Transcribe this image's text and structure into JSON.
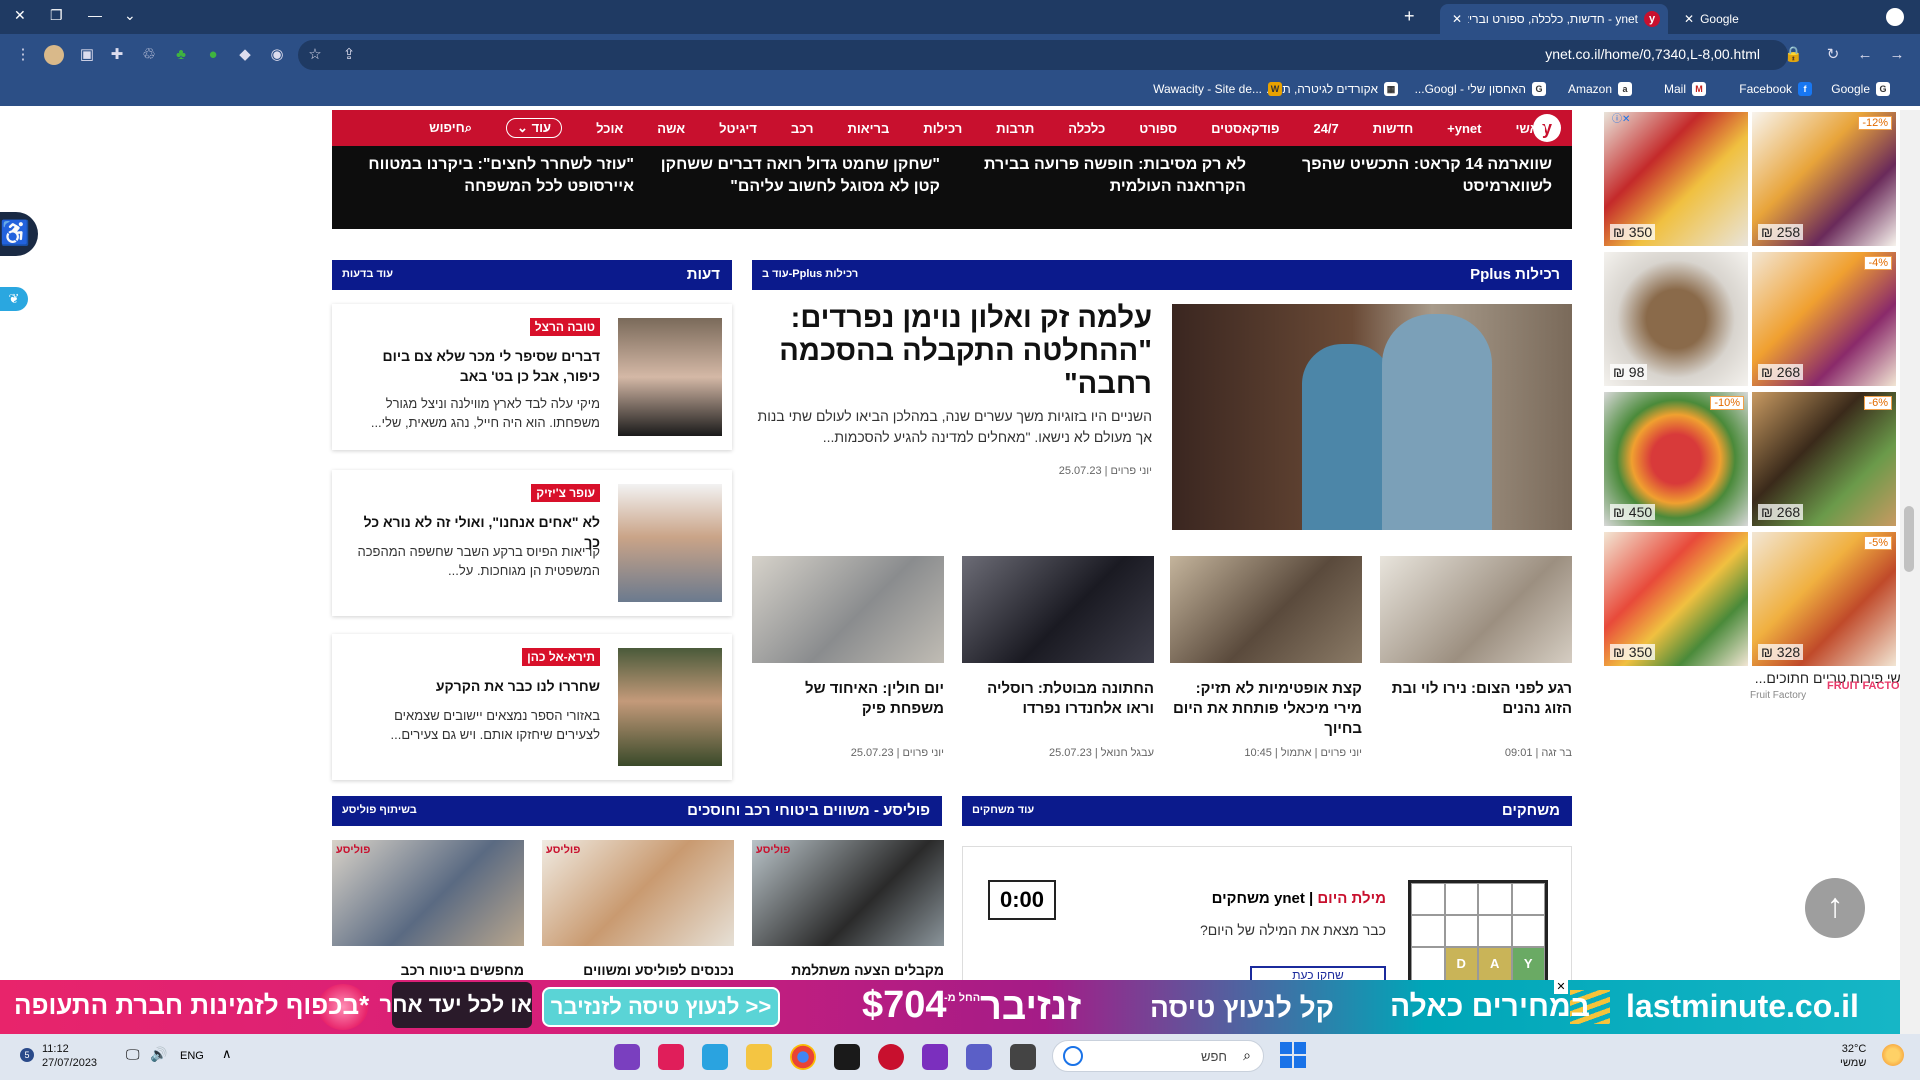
{
  "browser": {
    "tabs": [
      {
        "title": "Google",
        "favicon": "google-icon"
      },
      {
        "title": "ynet - חדשות, כלכלה, ספורט ובריאות - דיווחים שוטפים מהארץ ומהעולם",
        "favicon": "ynet-icon"
      }
    ],
    "url": "ynet.co.il/home/0,7340,L-8,00.html",
    "bookmarks": [
      "Google",
      "Facebook",
      "Mail",
      "Amazon",
      "האחסון שלי - Googl...",
      "אקורדים לגיטרה, תוו...",
      "Wawacity - Site de..."
    ]
  },
  "nav": {
    "logo": "y",
    "items": [
      "ראשי",
      "ynet+",
      "חדשות",
      "24/7",
      "פודקאסטים",
      "ספורט",
      "כלכלה",
      "תרבות",
      "רכילות",
      "בריאות",
      "רכב",
      "דיגיטל",
      "אשה",
      "אוכל"
    ],
    "more": "עוד",
    "search": "חיפוש"
  },
  "headlines": [
    "שווארמה 14 קראט: התכשיט שהפך לשווארמיסט",
    "לא רק מסיבות: חופשה פרועה בבירת הקרחאנה העולמית",
    "\"שחקן שחמט גדול רואה דברים ששחקן קטן לא מסוגל לחשוב עליהם\"",
    "\"עוזר לשחרר לחצים\": ביקרנו במטווח איירסופט לכל המשפחה"
  ],
  "gossip": {
    "header": "Pplus רכילות",
    "more": "עוד ב-Pplus רכילות",
    "main": {
      "title": "עלמה זק ואלון נוימן נפרדים: \"ההחלטה התקבלה בהסכמה רחבה\"",
      "desc": "השניים היו בזוגיות משך עשרים שנה, במהלכן הביאו לעולם שתי בנות אך מעולם לא נישאו. \"מאחלים למדינה להגיע להסכמות...",
      "byline": "יוני פרוים | 25.07.23"
    },
    "stories": [
      {
        "title": "רגע לפני הצום: נירו לוי ובת הזוג נהנים",
        "byline": "בר זגה | 09:01"
      },
      {
        "title": "קצת אופטימיות לא תזיק: מירי מיכאלי פותחת את היום בחיוך",
        "byline": "יוני פרוים | אתמול | 10:45"
      },
      {
        "title": "החתונה מבוטלת: רוסליה וראו אלחנדרו נפרדו",
        "byline": "עבגל חנואל | 25.07.23"
      },
      {
        "title": "יום חולין: האיחוד של משפחת פיק",
        "byline": "יוני פרוים | 25.07.23"
      }
    ]
  },
  "opinions": {
    "header": "דעות",
    "more": "עוד בדעות",
    "items": [
      {
        "author": "טובה הרצל",
        "title": "דברים שסיפר לי מכר שלא צם ביום כיפור, אבל כן בט' באב",
        "desc": "מיקי עלה לבד לארץ מווילנה וניצל מגורל משפחתו. הוא היה חייל, נהג משאית, שלי..."
      },
      {
        "author": "עופר צ'יזיק",
        "title": "לא \"אחים אנחנו\", ואולי זה לא נורא כל כך",
        "desc": "קריאות הפיוס ברקע השבר שחשפה המהפכה המשפטית הן מגוחכות. על..."
      },
      {
        "author": "תירא-אל כהן",
        "title": "שחררו לנו כבר את הקרקע",
        "desc": "באזורי הספר נמצאים יישובים שצמאים לצעירים שיחזקו אותם. ויש גם צעירים..."
      }
    ]
  },
  "policy": {
    "header": "פוליסע - משווים ביטוחי רכב וחוסכים",
    "partner": "בשיתוף פוליסע",
    "logo": "פוליסע",
    "items": [
      "מקבלים הצעה משתלמת",
      "נכנסים לפוליסע ומשווים",
      "מחפשים ביטוח רכב"
    ]
  },
  "games": {
    "header": "משחקים",
    "more": "עוד משחקים",
    "timer": "0:00",
    "title_brand": "ynet משחקים",
    "title_game": "מילת היום",
    "sub": "כבר מצאת את המילה של היום?",
    "play": "שחקו כעת",
    "letters": [
      "D",
      "A",
      "Y"
    ]
  },
  "ad": {
    "items": [
      {
        "price": "₪ 258",
        "discount": "-12%"
      },
      {
        "price": "₪ 350",
        "discount": ""
      },
      {
        "price": "₪ 268",
        "discount": "-4%"
      },
      {
        "price": "₪ 98",
        "discount": ""
      },
      {
        "price": "₪ 268",
        "discount": "-6%"
      },
      {
        "price": "₪ 450",
        "discount": "-10%"
      },
      {
        "price": "₪ 328",
        "discount": "-5%"
      },
      {
        "price": "₪ 350",
        "discount": ""
      }
    ],
    "caption": "מגשי פירות טריים חתוכים...",
    "brand": "FRUIT FACTORY",
    "sub": "Fruit Factory"
  },
  "banner": {
    "brand": "lastminute.co.il",
    "tagline1": "במחירים כאלה",
    "tagline2": "קל לנעוץ טיסה",
    "dest": "זנזיבר",
    "from": "החל מ-",
    "price": "$704",
    "button": "לנעוץ טיסה לזנזיבר >>",
    "slogan1": "או לכל יעד אחר",
    "slogan2": "*בכפוף לזמינות חברת התעופה"
  },
  "taskbar": {
    "time": "11:12",
    "date": "27/07/2023",
    "lang": "ENG",
    "weather_temp": "32°C",
    "weather_desc": "שמשי",
    "search": "חפש"
  }
}
